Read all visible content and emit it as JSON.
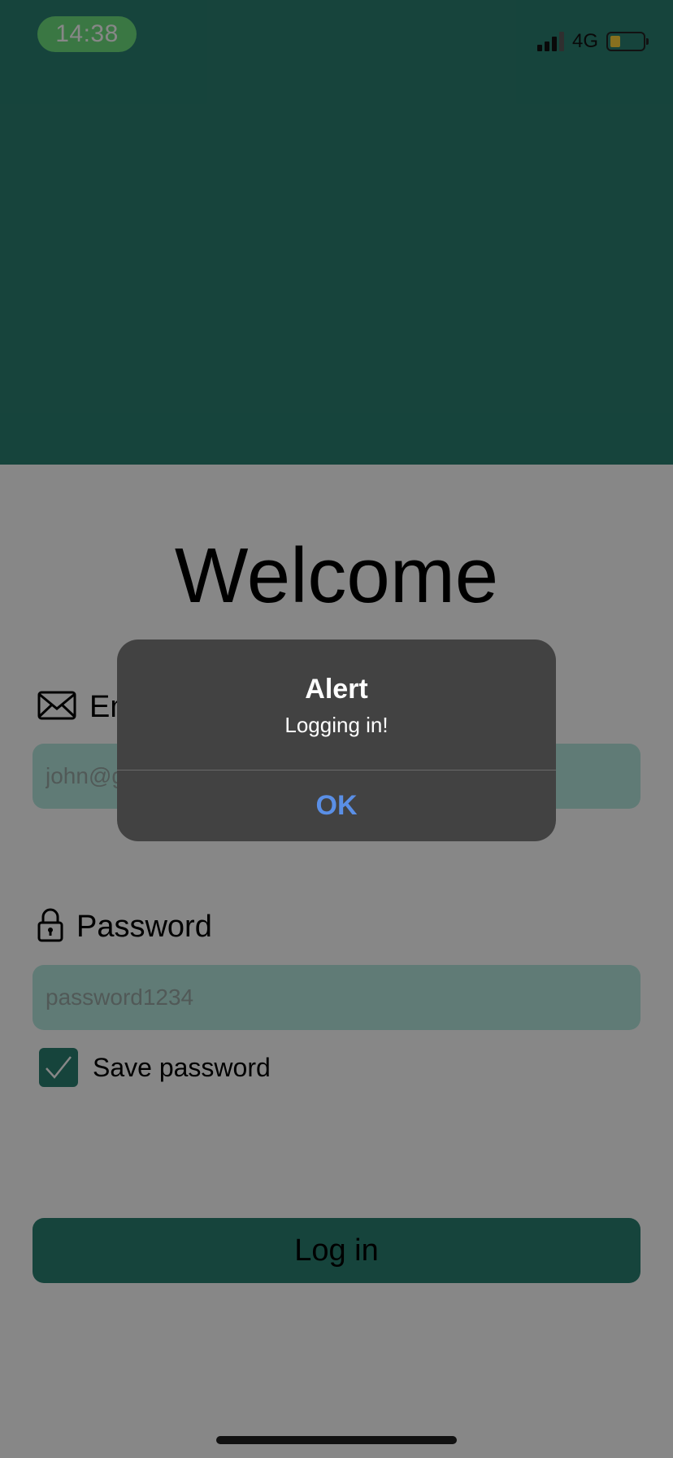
{
  "status_bar": {
    "time": "14:38",
    "network": "4G"
  },
  "welcome": {
    "title": "Welcome"
  },
  "email": {
    "label": "Email",
    "placeholder": "john@gmail.com"
  },
  "password": {
    "label": "Password",
    "placeholder": "password1234"
  },
  "save_password": {
    "label": "Save password",
    "checked": true
  },
  "login_button": {
    "label": "Log in"
  },
  "alert": {
    "title": "Alert",
    "message": "Logging in!",
    "ok_label": "OK"
  },
  "colors": {
    "accent": "#2b8072",
    "input_bg": "#b5e8df",
    "time_pill": "#6fe07f",
    "alert_bg": "#424242",
    "alert_button": "#5a8fe6",
    "battery": "#ffd43b"
  },
  "icons": {
    "email": "envelope-icon",
    "password": "lock-icon",
    "checkbox": "checkmark-icon"
  }
}
